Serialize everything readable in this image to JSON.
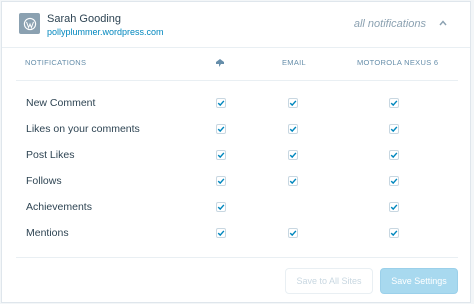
{
  "header": {
    "site_name": "Sarah Gooding",
    "site_url": "pollyplummer.wordpress.com",
    "filter_label": "all notifications"
  },
  "columns": {
    "notifications": "NOTIFICATIONS",
    "email": "EMAIL",
    "device": "MOTOROLA NEXUS 6"
  },
  "rows": [
    {
      "label": "New Comment",
      "timeline": true,
      "email": true,
      "device": true
    },
    {
      "label": "Likes on your comments",
      "timeline": true,
      "email": true,
      "device": true
    },
    {
      "label": "Post Likes",
      "timeline": true,
      "email": true,
      "device": true
    },
    {
      "label": "Follows",
      "timeline": true,
      "email": true,
      "device": true
    },
    {
      "label": "Achievements",
      "timeline": true,
      "email": null,
      "device": true
    },
    {
      "label": "Mentions",
      "timeline": true,
      "email": true,
      "device": true
    }
  ],
  "buttons": {
    "save_all": "Save to All Sites",
    "save": "Save Settings"
  },
  "icons": {
    "site": "wordpress-globe-icon",
    "filter": "chevron-up-icon",
    "timeline_column": "notification-bell-icon",
    "check": "checkmark-icon"
  },
  "colors": {
    "accent": "#0087be",
    "checkmark": "#0087be",
    "primary_button": "#a8d9ef"
  }
}
